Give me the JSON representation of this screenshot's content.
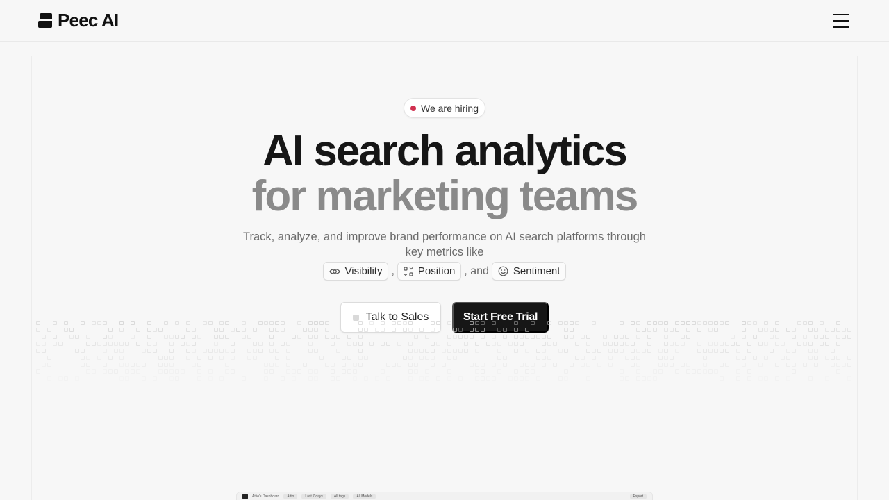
{
  "header": {
    "brand": "Peec AI",
    "menu_icon": "hamburger-menu-icon"
  },
  "hero": {
    "badge": "We are hiring",
    "badge_dot_color": "#d0304f",
    "title_line1": "AI search analytics",
    "title_line2": "for marketing teams",
    "subtitle": "Track, analyze, and improve brand performance on AI search platforms through key metrics like",
    "metrics": [
      {
        "label": "Visibility",
        "icon": "eye-icon"
      },
      {
        "label": "Position",
        "icon": "position-icon"
      },
      {
        "label": "Sentiment",
        "icon": "smile-icon"
      }
    ],
    "sep_comma": ",",
    "sep_and": ", and"
  },
  "cta": {
    "sales": "Talk to Sales",
    "trial": "Start Free Trial"
  },
  "preview": {
    "title": "Attio's Dashboard",
    "brand": "Attio",
    "filters": [
      "Last 7 days",
      "All tags",
      "All Models"
    ],
    "export": "Export"
  },
  "colors": {
    "background": "#f7f7f7",
    "primary_button": "#161616",
    "title_secondary": "#8a8a8a"
  }
}
